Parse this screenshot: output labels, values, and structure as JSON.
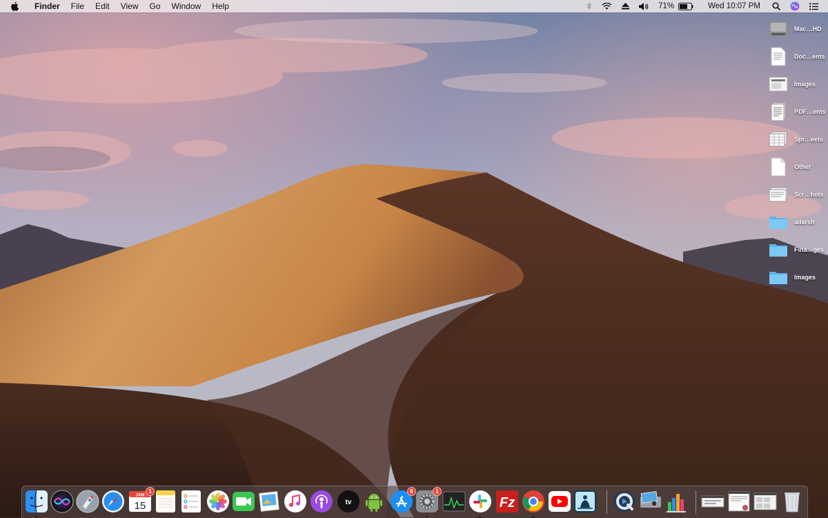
{
  "menubar": {
    "app_name": "Finder",
    "items": [
      "File",
      "Edit",
      "View",
      "Go",
      "Window",
      "Help"
    ],
    "battery": "71%",
    "clock": "Wed 10:07 PM"
  },
  "desktop": {
    "items": [
      {
        "label": "Mac…HD",
        "icon": "hard-drive-icon"
      },
      {
        "label": "Doc…ents",
        "icon": "document-icon"
      },
      {
        "label": "Images",
        "icon": "image-file-icon"
      },
      {
        "label": "PDF…ents",
        "icon": "pdf-stack-icon"
      },
      {
        "label": "Spr…eets",
        "icon": "spreadsheet-icon"
      },
      {
        "label": "Other",
        "icon": "blank-document-icon"
      },
      {
        "label": "Scr…hots",
        "icon": "screenshot-icon"
      },
      {
        "label": "adarsh",
        "icon": "folder-icon"
      },
      {
        "label": "Fina…ges",
        "icon": "folder-icon"
      },
      {
        "label": "Images",
        "icon": "folder-icon"
      }
    ]
  },
  "dock": {
    "calendar": {
      "month": "JAN",
      "day": "15"
    },
    "badges": {
      "calendar": "1",
      "app_store": "6",
      "system_preferences": "1"
    },
    "apps": [
      "finder",
      "siri",
      "launchpad",
      "safari",
      "calendar",
      "notes",
      "reminders",
      "photos",
      "facetime",
      "preview",
      "music",
      "podcasts",
      "tv",
      "android-studio",
      "app-store",
      "system-preferences",
      "activity-monitor",
      "slack",
      "filezilla",
      "chrome",
      "youtube",
      "kindle",
      "quicktime",
      "image-capture",
      "numbers",
      "window-thumb-1",
      "window-thumb-2",
      "window-thumb-3",
      "trash"
    ]
  }
}
